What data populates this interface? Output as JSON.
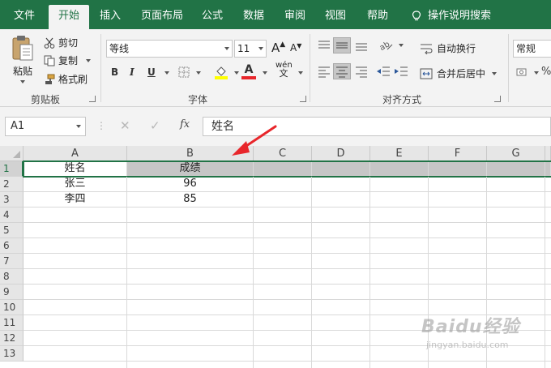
{
  "menu": {
    "tabs": [
      "文件",
      "开始",
      "插入",
      "页面布局",
      "公式",
      "数据",
      "审阅",
      "视图",
      "帮助"
    ],
    "active_index": 1,
    "tell_me": "操作说明搜索"
  },
  "ribbon": {
    "clipboard": {
      "paste": "粘贴",
      "cut": "剪切",
      "copy": "复制",
      "format_painter": "格式刷",
      "label": "剪贴板"
    },
    "font": {
      "name": "等线",
      "size": "11",
      "increase": "A",
      "decrease": "A",
      "bold": "B",
      "italic": "I",
      "underline": "U",
      "font_color_letter": "A",
      "phonetic": "wén",
      "label": "字体"
    },
    "alignment": {
      "wrap_text": "自动换行",
      "merge_center": "合并后居中",
      "label": "对齐方式"
    },
    "number": {
      "format": "常规"
    }
  },
  "formula_bar": {
    "name_box": "A1",
    "fx": "fx",
    "content": "姓名"
  },
  "sheet": {
    "columns": [
      "A",
      "B",
      "C",
      "D",
      "E",
      "F",
      "G"
    ],
    "rows": [
      "1",
      "2",
      "3",
      "4",
      "5",
      "6",
      "7",
      "8",
      "9",
      "10",
      "11",
      "12",
      "13"
    ],
    "cells": [
      [
        "姓名",
        "成绩"
      ],
      [
        "张三",
        "96"
      ],
      [
        "李四",
        "85"
      ]
    ]
  },
  "colors": {
    "accent": "#217346",
    "annotation_arrow": "#e8262b"
  },
  "watermark": {
    "brand": "Baidu经验",
    "url": "jingyan.baidu.com"
  }
}
